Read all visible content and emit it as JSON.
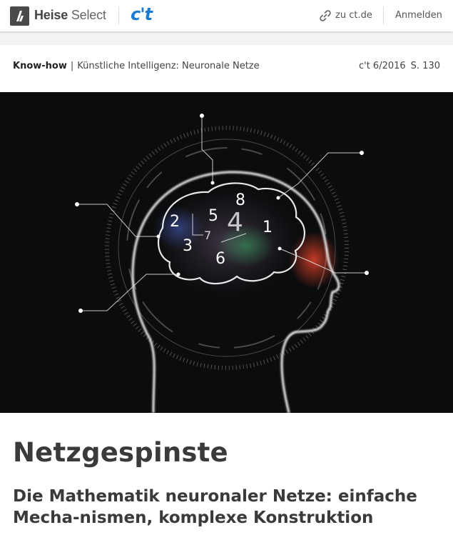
{
  "header": {
    "brand_bold": "Heise",
    "brand_light": "Select",
    "magazine_logo": "c't",
    "external_link_label": "zu ct.de",
    "login_label": "Anmelden",
    "icons": {
      "logo": "heise-logo-icon",
      "link": "link-icon"
    },
    "colors": {
      "magazine_accent": "#1b7bd2"
    }
  },
  "breadcrumb": {
    "section": "Know-how",
    "separator": "|",
    "topic": "Künstliche Intelligenz: Neuronale Netze"
  },
  "issue": {
    "edition": "c't 6/2016",
    "page": "S. 130"
  },
  "hero": {
    "digits": [
      "2",
      "5",
      "8",
      "4",
      "1",
      "3",
      "7",
      "6"
    ]
  },
  "article": {
    "title": "Netzgespinste",
    "subtitle": "Die Mathematik neuronaler Netze: einfache Mecha-nismen, komplexe Konstruktion"
  }
}
